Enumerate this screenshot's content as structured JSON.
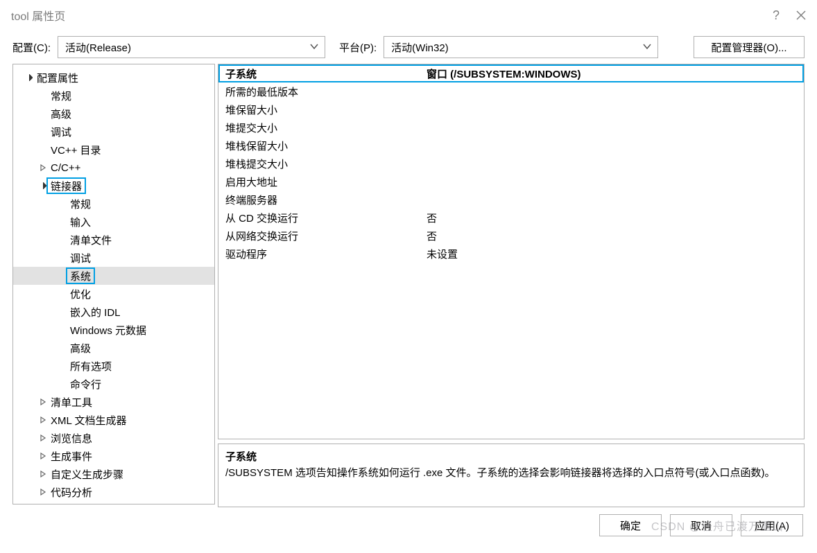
{
  "window": {
    "title": "tool 属性页"
  },
  "toolbar": {
    "config_label": "配置(C):",
    "config_value": "活动(Release)",
    "platform_label": "平台(P):",
    "platform_value": "活动(Win32)",
    "config_manager": "配置管理器(O)..."
  },
  "tree": [
    {
      "label": "配置属性",
      "depth": 0,
      "exp": "open"
    },
    {
      "label": "常规",
      "depth": 1
    },
    {
      "label": "高级",
      "depth": 1
    },
    {
      "label": "调试",
      "depth": 1
    },
    {
      "label": "VC++ 目录",
      "depth": 1
    },
    {
      "label": "C/C++",
      "depth": 1,
      "exp": "closed"
    },
    {
      "label": "链接器",
      "depth": 1,
      "exp": "open",
      "hl": true
    },
    {
      "label": "常规",
      "depth": 2
    },
    {
      "label": "输入",
      "depth": 2
    },
    {
      "label": "清单文件",
      "depth": 2
    },
    {
      "label": "调试",
      "depth": 2
    },
    {
      "label": "系统",
      "depth": 2,
      "selected": true,
      "hl": true
    },
    {
      "label": "优化",
      "depth": 2
    },
    {
      "label": "嵌入的 IDL",
      "depth": 2
    },
    {
      "label": "Windows 元数据",
      "depth": 2
    },
    {
      "label": "高级",
      "depth": 2
    },
    {
      "label": "所有选项",
      "depth": 2
    },
    {
      "label": "命令行",
      "depth": 2
    },
    {
      "label": "清单工具",
      "depth": 1,
      "exp": "closed"
    },
    {
      "label": "XML 文档生成器",
      "depth": 1,
      "exp": "closed"
    },
    {
      "label": "浏览信息",
      "depth": 1,
      "exp": "closed"
    },
    {
      "label": "生成事件",
      "depth": 1,
      "exp": "closed"
    },
    {
      "label": "自定义生成步骤",
      "depth": 1,
      "exp": "closed"
    },
    {
      "label": "代码分析",
      "depth": 1,
      "exp": "closed"
    }
  ],
  "props": [
    {
      "name": "子系统",
      "value": "窗口 (/SUBSYSTEM:WINDOWS)",
      "hl": true
    },
    {
      "name": "所需的最低版本",
      "value": ""
    },
    {
      "name": "堆保留大小",
      "value": ""
    },
    {
      "name": "堆提交大小",
      "value": ""
    },
    {
      "name": "堆栈保留大小",
      "value": ""
    },
    {
      "name": "堆栈提交大小",
      "value": ""
    },
    {
      "name": "启用大地址",
      "value": ""
    },
    {
      "name": "终端服务器",
      "value": ""
    },
    {
      "name": "从 CD 交换运行",
      "value": "否"
    },
    {
      "name": "从网络交换运行",
      "value": "否"
    },
    {
      "name": "驱动程序",
      "value": "未设置"
    }
  ],
  "desc": {
    "title": "子系统",
    "body": "/SUBSYSTEM 选项告知操作系统如何运行 .exe 文件。子系统的选择会影响链接器将选择的入口点符号(或入口点函数)。"
  },
  "footer": {
    "ok": "确定",
    "cancel": "取消",
    "apply": "应用(A)"
  },
  "watermark": "CSDN @轻舟已渡万重山"
}
